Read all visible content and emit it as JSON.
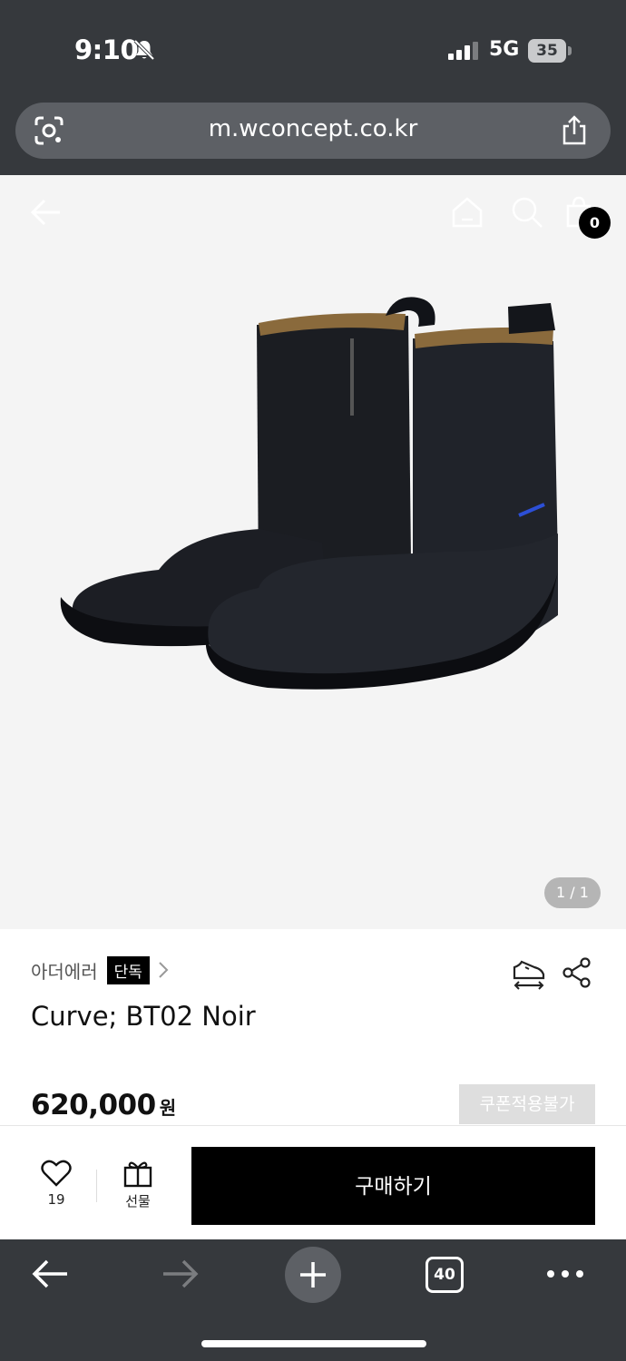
{
  "status_bar": {
    "time": "9:10",
    "network": "5G",
    "battery": "35"
  },
  "browser": {
    "url": "m.wconcept.co.kr",
    "open_tabs": "40"
  },
  "product": {
    "image_counter": "1 / 1",
    "cart_count": "0",
    "brand": "아더에러",
    "badge": "단독",
    "title": "Curve; BT02 Noir",
    "price": "620,000",
    "currency": "원",
    "coupon_label": "쿠폰적용불가"
  },
  "purchase_bar": {
    "like_count": "19",
    "gift_label": "선물",
    "buy_label": "구매하기"
  },
  "icons": [
    "bell-slash-icon",
    "signal-icon",
    "lens-icon",
    "share-icon",
    "back-arrow-icon",
    "home-icon",
    "search-icon",
    "shopping-bag-icon",
    "chevron-right-icon",
    "size-guide-icon",
    "share-nodes-icon",
    "heart-icon",
    "gift-icon",
    "forward-arrow-icon",
    "plus-icon",
    "more-icon"
  ],
  "colors": {
    "chrome": "#36393d",
    "url_bar": "#5d6065",
    "accent": "#000000",
    "image_background": "#f4f4f4"
  }
}
